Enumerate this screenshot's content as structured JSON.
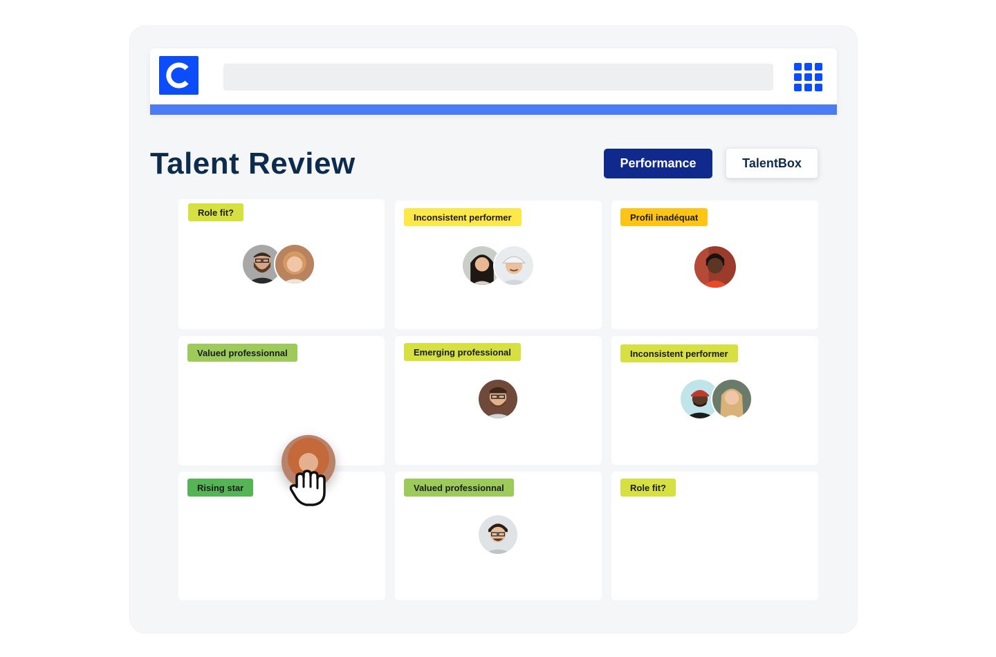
{
  "page": {
    "title": "Talent Review"
  },
  "header": {
    "logo_letter": "C",
    "search_value": "",
    "apps_icon": "grid-apps-icon"
  },
  "tabs": {
    "performance_label": "Performance",
    "talentbox_label": "TalentBox"
  },
  "colors": {
    "brand_blue": "#0b4dfa",
    "accent_line": "#4b7cf5",
    "performance_button": "#0f2a8c",
    "title_text": "#0d2b4c",
    "tag_lime": "#d6e040",
    "tag_yellow": "#fde84a",
    "tag_amber": "#ffc414",
    "tag_light_green": "#9dcb5a",
    "tag_green": "#55b556"
  },
  "grid": {
    "cells": [
      {
        "tag": "Role fit?",
        "tag_color": "#d6e040",
        "avatars": [
          "man-glasses-beard",
          "woman-blonde"
        ]
      },
      {
        "tag": "Inconsistent performer",
        "tag_color": "#fde84a",
        "avatars": [
          "woman-dark-hair",
          "man-cap"
        ]
      },
      {
        "tag": "Profil inadéquat",
        "tag_color": "#ffc414",
        "avatars": [
          "woman-red-top"
        ]
      },
      {
        "tag": "Valued professionnal",
        "tag_color": "#9dcb5a",
        "avatars": []
      },
      {
        "tag": "Emerging professional",
        "tag_color": "#d6e040",
        "avatars": [
          "man-glasses-beard-2"
        ]
      },
      {
        "tag": "Inconsistent performer",
        "tag_color": "#d6e040",
        "avatars": [
          "man-beanie",
          "woman-long-hair"
        ]
      },
      {
        "tag": "Rising star",
        "tag_color": "#55b556",
        "avatars": []
      },
      {
        "tag": "Valued professionnal",
        "tag_color": "#9dcb5a",
        "avatars": [
          "man-glasses-curly"
        ]
      },
      {
        "tag": "Role fit?",
        "tag_color": "#d6e040",
        "avatars": []
      }
    ]
  },
  "dragging": {
    "avatar": "woman-curly-hair",
    "cursor_icon": "grab-hand-icon"
  }
}
